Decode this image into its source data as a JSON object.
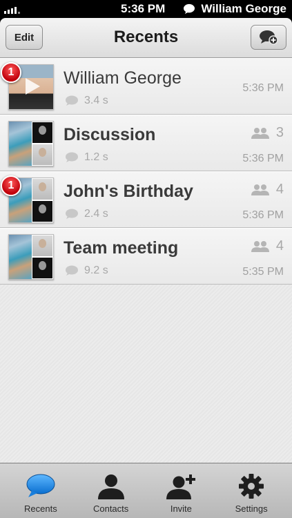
{
  "status_bar": {
    "time": "5:36 PM",
    "user": "William George"
  },
  "nav": {
    "title": "Recents",
    "edit_label": "Edit",
    "compose_icon": "new-message-icon"
  },
  "rows": [
    {
      "title": "William George",
      "duration": "3.4 s",
      "time": "5:36 PM",
      "badge": "1",
      "thumb": "person-photo",
      "count": null
    },
    {
      "title": "Discussion",
      "duration": "1.2 s",
      "time": "5:36 PM",
      "badge": null,
      "thumb": "group-photos",
      "count": "3"
    },
    {
      "title": "John's Birthday",
      "duration": "2.4 s",
      "time": "5:36 PM",
      "badge": "1",
      "thumb": "group-photos",
      "count": "4"
    },
    {
      "title": "Team meeting",
      "duration": "9.2 s",
      "time": "5:35 PM",
      "badge": null,
      "thumb": "group-photos",
      "count": "4"
    }
  ],
  "tabs": [
    {
      "label": "Recents",
      "icon": "speech-bubble-icon",
      "active": true,
      "color": "#1a8ae6"
    },
    {
      "label": "Contacts",
      "icon": "person-icon",
      "active": false
    },
    {
      "label": "Invite",
      "icon": "add-person-icon",
      "active": false
    },
    {
      "label": "Settings",
      "icon": "gear-icon",
      "active": false
    }
  ]
}
